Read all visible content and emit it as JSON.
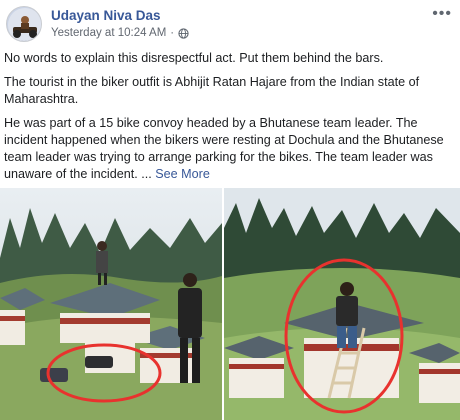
{
  "post": {
    "author": "Udayan Niva Das",
    "timestamp": "Yesterday at 10:24 AM",
    "separator": "·",
    "paragraphs": [
      "No words to explain this disrespectful act. Put them behind the bars.",
      "The tourist in the biker outfit is Abhijit Ratan Hajare from the Indian state of Maharashtra."
    ],
    "last_paragraph": "He was part of a 15 bike convoy headed by a Bhutanese team leader. The incident happened when the bikers were resting at Dochula and the Bhutanese team leader was trying to arrange parking for the bikes. The team leader was unaware of the incident. ...",
    "see_more": "See More",
    "more_options": "•••"
  },
  "icons": {
    "privacy": "globe-icon",
    "options": "more-options-icon"
  },
  "colors": {
    "author_link": "#385898",
    "meta_text": "#616770",
    "highlight_circle": "#e8322e"
  }
}
